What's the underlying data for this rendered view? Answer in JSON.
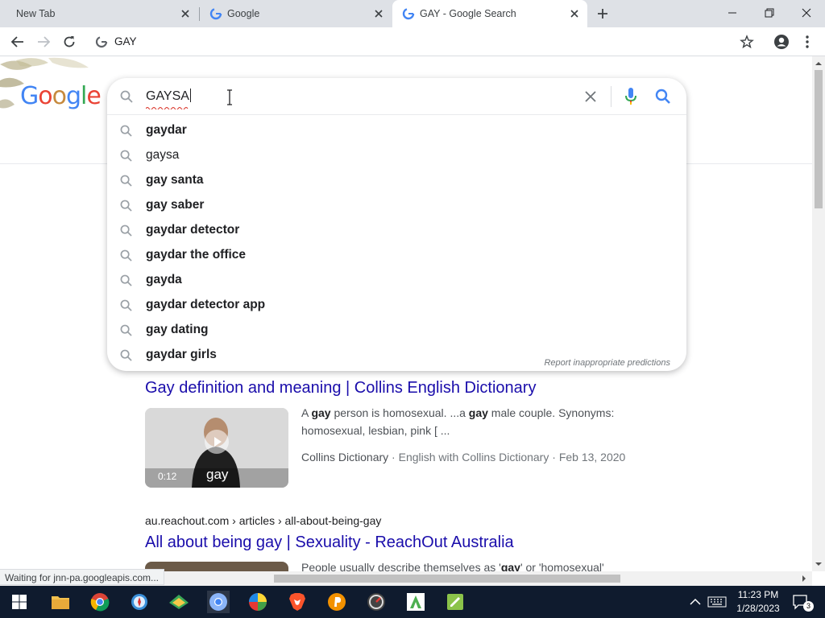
{
  "tabs": [
    {
      "label": "New Tab"
    },
    {
      "label": "Google"
    },
    {
      "label": "GAY - Google Search"
    }
  ],
  "omnibox": {
    "value": "GAY"
  },
  "logo": {
    "letters": [
      "G",
      "o",
      "o",
      "g",
      "l",
      "e"
    ]
  },
  "search": {
    "value": "GAYSA",
    "report_label": "Report inappropriate predictions"
  },
  "suggestions": [
    {
      "text": "gaydar",
      "bold": true
    },
    {
      "text": "gaysa",
      "bold": false
    },
    {
      "text": "gay santa",
      "bold": true
    },
    {
      "text": "gay saber",
      "bold": true
    },
    {
      "text": "gaydar detector",
      "bold": true
    },
    {
      "text": "gaydar the office",
      "bold": true
    },
    {
      "text": "gayda",
      "bold": true
    },
    {
      "text": "gaydar detector app",
      "bold": true
    },
    {
      "text": "gay dating",
      "bold": true
    },
    {
      "text": "gaydar girls",
      "bold": true
    }
  ],
  "results": [
    {
      "title": "Gay definition and meaning | Collins English Dictionary",
      "snippet_parts": [
        "A ",
        "gay",
        " person is homosexual. ...a ",
        "gay",
        " male couple. Synonyms: homosexual, lesbian, pink [ ..."
      ],
      "source": "Collins Dictionary",
      "channel": "English with Collins Dictionary",
      "date": "Feb 13, 2020",
      "video_duration": "0:12",
      "video_caption": "gay"
    },
    {
      "cite": "au.reachout.com › articles › all-about-being-gay",
      "title": "All about being gay | Sexuality - ReachOut Australia",
      "snippet_parts": [
        "People usually describe themselves as '",
        "gay",
        "' or 'homosexual'"
      ]
    }
  ],
  "status": {
    "text": "Waiting for jnn-pa.googleapis.com..."
  },
  "clock": {
    "time": "11:23 PM",
    "date": "1/28/2023"
  },
  "notifications": {
    "count": "3"
  },
  "colors": {
    "link": "#1a0dab",
    "tabbar": "#dee1e6",
    "taskbar": "#0f1b2e"
  }
}
